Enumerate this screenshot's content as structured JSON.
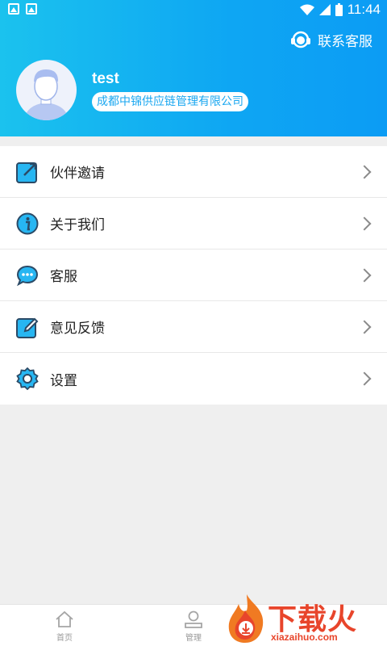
{
  "status_bar": {
    "time": "11:44"
  },
  "header": {
    "contact_label": "联系客服",
    "username": "test",
    "company": "成都中锦供应链管理有限公司"
  },
  "menu": [
    {
      "label": "伙伴邀请",
      "icon": "share-icon"
    },
    {
      "label": "关于我们",
      "icon": "info-icon"
    },
    {
      "label": "客服",
      "icon": "chat-icon"
    },
    {
      "label": "意见反馈",
      "icon": "edit-icon"
    },
    {
      "label": "设置",
      "icon": "gear-icon"
    }
  ],
  "tabbar": [
    {
      "label": "首页",
      "icon": "home-icon"
    },
    {
      "label": "管理",
      "icon": "user-icon"
    }
  ],
  "watermark": {
    "text": "下载火",
    "url": "xiazaihuo.com"
  },
  "colors": {
    "accent": "#0ea6f3",
    "watermark": "#e8452b"
  }
}
